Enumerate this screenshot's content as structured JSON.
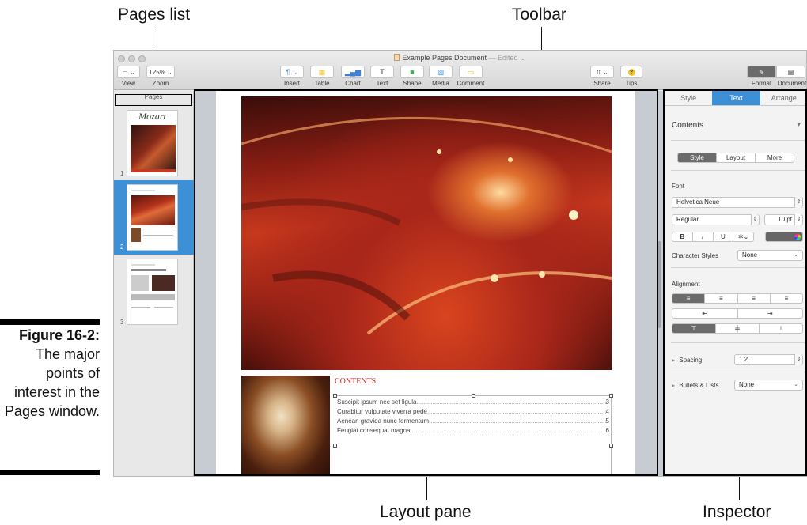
{
  "callouts": {
    "pages_list": "Pages list",
    "toolbar": "Toolbar",
    "layout_pane": "Layout pane",
    "inspector": "Inspector"
  },
  "figure": {
    "number": "Figure 16-2:",
    "caption": "The major points of interest in the Pages window."
  },
  "window": {
    "doc_name": "Example Pages Document",
    "doc_status": "— Edited ⌄"
  },
  "toolbar": {
    "view_label": "View",
    "zoom_value": "125% ⌄",
    "zoom_label": "Zoom",
    "items": [
      {
        "label": "Insert",
        "glyph": "¶ ⌄",
        "color": "#5b8dd9"
      },
      {
        "label": "Table",
        "glyph": "▦",
        "color": "#f2c12e"
      },
      {
        "label": "Chart",
        "glyph": "▂▄▆",
        "color": "#3d7fd6"
      },
      {
        "label": "Text",
        "glyph": "T",
        "color": "#333333"
      },
      {
        "label": "Shape",
        "glyph": "■",
        "color": "#3cb64a"
      },
      {
        "label": "Media",
        "glyph": "▨",
        "color": "#3d8fd6"
      },
      {
        "label": "Comment",
        "glyph": "▭",
        "color": "#f2c12e"
      }
    ],
    "share_label": "Share",
    "tips_label": "Tips",
    "format_label": "Format",
    "document_label": "Document"
  },
  "sidebar": {
    "heading": "Pages",
    "thumb_title": "Mozart",
    "thumb_numbers": [
      "1",
      "2",
      "3"
    ]
  },
  "page": {
    "contents_heading": "CONTENTS",
    "toc": [
      {
        "text": "Suscipit ipsum nec set ligula",
        "page": "3"
      },
      {
        "text": "Curabitur vulputate viverra pede",
        "page": "4"
      },
      {
        "text": "Aenean gravida nunc fermentum",
        "page": "5"
      },
      {
        "text": "Feugiat consequat magna",
        "page": "6"
      }
    ]
  },
  "inspector": {
    "tabs": [
      "Style",
      "Text",
      "Arrange"
    ],
    "active_tab": "Text",
    "paragraph_style": "Contents",
    "sub_tabs": [
      "Style",
      "Layout",
      "More"
    ],
    "font_heading": "Font",
    "font_family": "Helvetica Neue",
    "font_weight": "Regular",
    "font_size": "10 pt",
    "style_buttons": [
      "B",
      "I",
      "U",
      "✲⌄"
    ],
    "char_styles_label": "Character Styles",
    "char_styles_value": "None",
    "alignment_heading": "Alignment",
    "spacing_label": "Spacing",
    "spacing_value": "1.2",
    "bullets_label": "Bullets & Lists",
    "bullets_value": "None"
  }
}
